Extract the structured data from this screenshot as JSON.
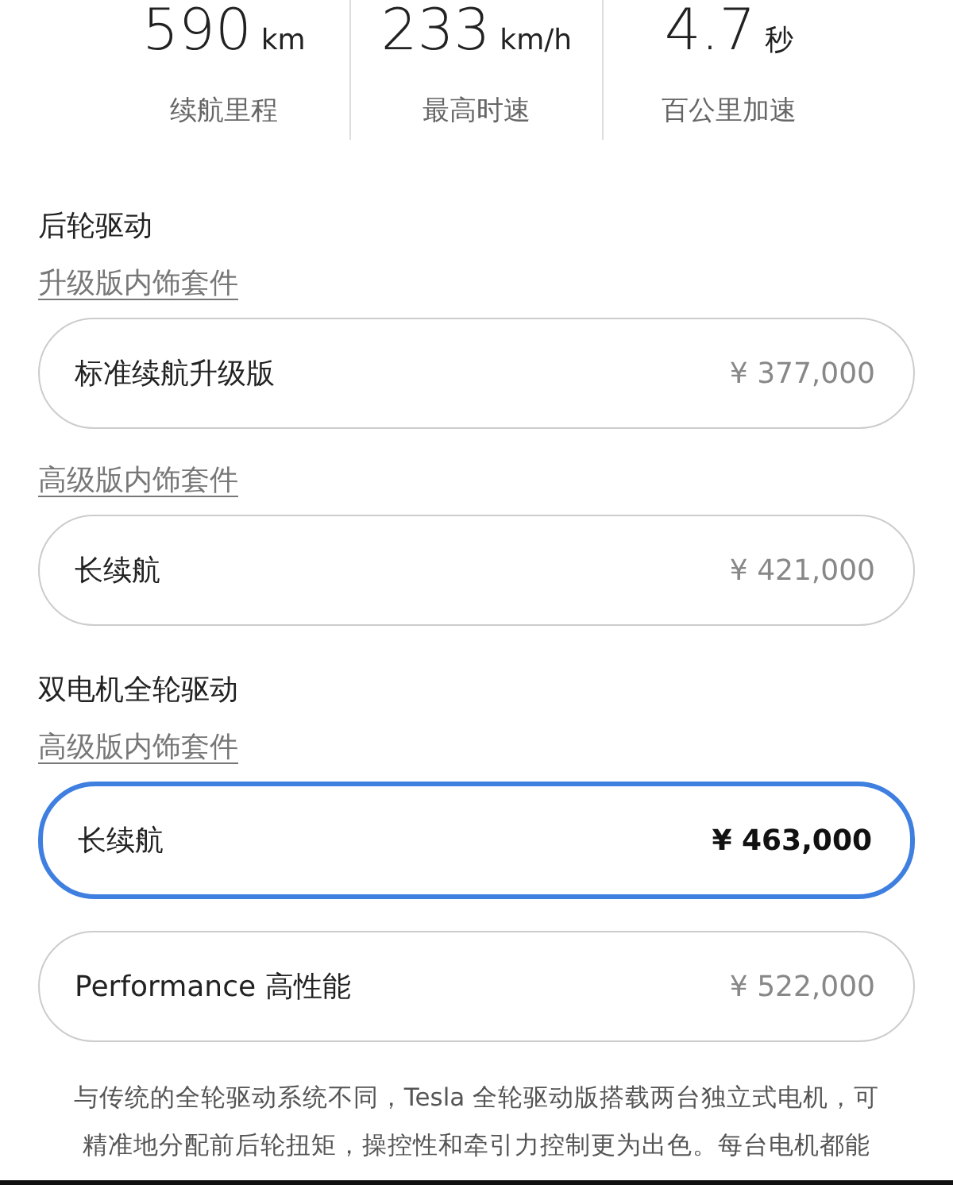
{
  "stats": [
    {
      "value": "590",
      "unit": "km",
      "label": "续航里程"
    },
    {
      "value": "233",
      "unit": "km/h",
      "label": "最高时速"
    },
    {
      "value": "4.7",
      "unit": "秒",
      "label": "百公里加速"
    }
  ],
  "groups": [
    {
      "title": "后轮驱动",
      "packages": [
        {
          "label": "升级版内饰套件",
          "options": [
            {
              "name": "标准续航升级版",
              "price": "¥ 377,000",
              "selected": false
            }
          ]
        },
        {
          "label": "高级版内饰套件",
          "options": [
            {
              "name": "长续航",
              "price": "¥ 421,000",
              "selected": false
            }
          ]
        }
      ]
    },
    {
      "title": "双电机全轮驱动",
      "packages": [
        {
          "label": "高级版内饰套件",
          "options": [
            {
              "name": "长续航",
              "price": "¥ 463,000",
              "selected": true
            },
            {
              "name": "Performance 高性能",
              "price": "¥ 522,000",
              "selected": false
            }
          ]
        }
      ]
    }
  ],
  "description": "与传统的全轮驱动系统不同，Tesla 全轮驱动版搭载两台独立式电机，可精准地分配前后轮扭矩，操控性和牵引力控制更为出色。每台电机都能"
}
